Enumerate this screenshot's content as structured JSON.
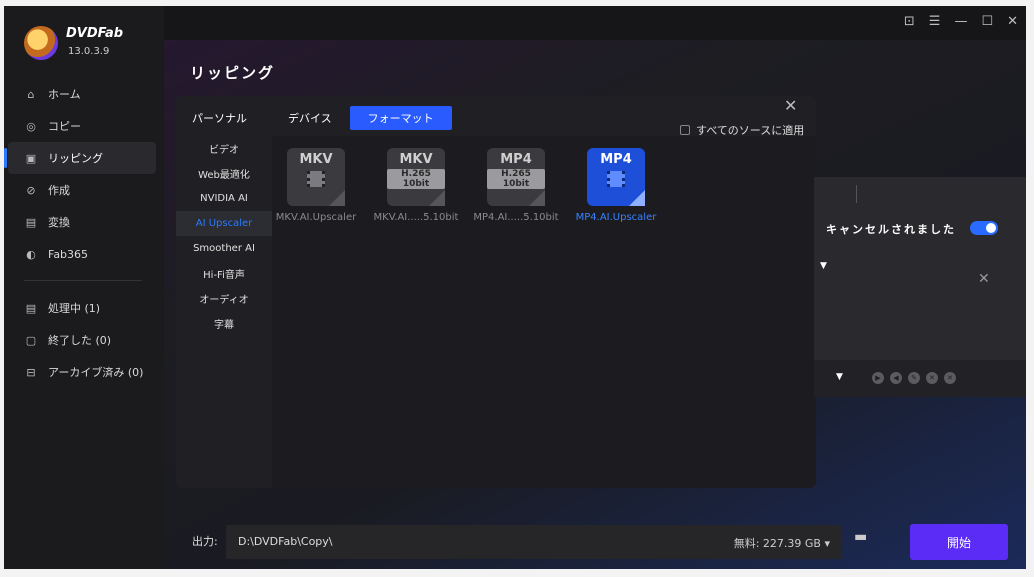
{
  "app": {
    "brand": "DVDFab",
    "version": "13.0.3.9"
  },
  "sidebar": {
    "items": [
      {
        "label": "ホーム",
        "icon": "home-icon",
        "glyph": "⌂"
      },
      {
        "label": "コピー",
        "icon": "copy-icon",
        "glyph": "◎"
      },
      {
        "label": "リッピング",
        "icon": "ripper-icon",
        "glyph": "▣"
      },
      {
        "label": "作成",
        "icon": "create-icon",
        "glyph": "⊘"
      },
      {
        "label": "変換",
        "icon": "convert-icon",
        "glyph": "▤"
      },
      {
        "label": "Fab365",
        "icon": "fab365-icon",
        "glyph": "◐"
      }
    ],
    "queue": [
      {
        "label": "処理中 (1)",
        "icon": "processing-icon",
        "glyph": "▤"
      },
      {
        "label": "終了した (0)",
        "icon": "finished-icon",
        "glyph": "▢"
      },
      {
        "label": "アーカイブ済み (0)",
        "icon": "archive-icon",
        "glyph": "⊟"
      }
    ]
  },
  "titlebar": {
    "icons": [
      "skin-icon",
      "menu-icon",
      "minimize-icon",
      "maximize-icon",
      "close-icon"
    ]
  },
  "main": {
    "title": "リッピング"
  },
  "profile": {
    "category_header": "パーソナル",
    "tabs": [
      "デバイス",
      "フォーマット"
    ],
    "active_tab": "フォーマット",
    "apply_all": "すべてのソースに適用",
    "categories": [
      "ビデオ",
      "Web最適化",
      "NVIDIA AI",
      "AI Upscaler",
      "Smoother AI",
      "Hi-Fi音声",
      "オーディオ",
      "字幕"
    ],
    "active_category": "AI Upscaler",
    "formats": [
      {
        "ext": "MKV",
        "badge": "",
        "label": "MKV.AI.Upscaler"
      },
      {
        "ext": "MKV",
        "badge": "H.265 10bit",
        "label": "MKV.AI.....5.10bit"
      },
      {
        "ext": "MP4",
        "badge": "H.265 10bit",
        "label": "MP4.AI.....5.10bit"
      },
      {
        "ext": "MP4",
        "badge": "",
        "label": "MP4.AI.Upscaler"
      }
    ],
    "active_format": 3
  },
  "right_panel": {
    "status_text": "キャンセルされました",
    "toggle_on": true
  },
  "bottom": {
    "output_label": "出力:",
    "path": "D:\\DVDFab\\Copy\\",
    "free_space": "無料: 227.39 GB ▾",
    "start_label": "開始"
  },
  "colors": {
    "accent": "#2a7bff",
    "start_button": "#5b2cf6",
    "active_format": "#1d4fd8"
  }
}
